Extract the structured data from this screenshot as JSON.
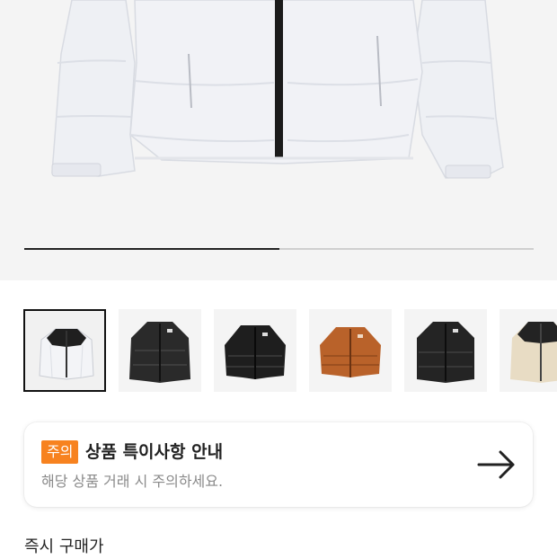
{
  "gallery": {
    "image_progress": 0.5,
    "thumbnails": [
      {
        "label": "white-black-jacket",
        "selected": true
      },
      {
        "label": "black-jacket",
        "selected": false
      },
      {
        "label": "black-jacket-2",
        "selected": false
      },
      {
        "label": "brown-jacket",
        "selected": false
      },
      {
        "label": "black-jacket-3",
        "selected": false
      },
      {
        "label": "cream-black-jacket",
        "selected": false
      }
    ]
  },
  "notice": {
    "badge": "주의",
    "title": "상품 특이사항 안내",
    "subtitle": "해당 상품 거래 시 주의하세요.",
    "arrow_icon": "arrow-right-icon"
  },
  "price": {
    "label": "즉시 구매가"
  },
  "colors": {
    "badge": "#f7821f",
    "hero_bg": "#f4f4f4"
  }
}
